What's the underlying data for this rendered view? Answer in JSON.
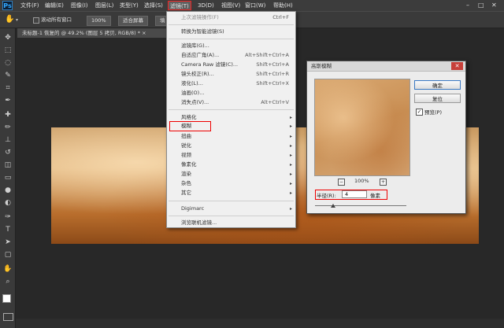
{
  "menubar": {
    "logo": "Ps",
    "items": [
      "文件(F)",
      "编辑(E)",
      "图像(I)",
      "图层(L)",
      "类型(Y)",
      "选择(S)",
      "滤镜(T)",
      "3D(D)",
      "视图(V)",
      "窗口(W)",
      "帮助(H)"
    ],
    "window_controls": [
      "–",
      "□",
      "✕"
    ]
  },
  "options_bar": {
    "checkbox_label": "滚动所有窗口",
    "zoom_value": "100%",
    "fit_screen": "适合屏幕",
    "fill_screen": "填"
  },
  "document": {
    "tab_title": "未标题-1 恢复的 @ 49.2% (图层 5 拷贝, RGB/8) * ×"
  },
  "filter_menu": {
    "top_items": [
      {
        "label": "上次滤镜操作(F)",
        "shortcut": "Ctrl+F",
        "disabled": true
      },
      {
        "label": "转换为智能滤镜(S)",
        "shortcut": "",
        "disabled": false
      }
    ],
    "mid_items": [
      {
        "label": "滤镜库(G)...",
        "shortcut": ""
      },
      {
        "label": "自适应广角(A)...",
        "shortcut": "Alt+Shift+Ctrl+A"
      },
      {
        "label": "Camera Raw 滤镜(C)...",
        "shortcut": "Shift+Ctrl+A"
      },
      {
        "label": "镜头校正(R)...",
        "shortcut": "Shift+Ctrl+R"
      },
      {
        "label": "液化(L)...",
        "shortcut": "Shift+Ctrl+X"
      },
      {
        "label": "油画(O)...",
        "shortcut": ""
      },
      {
        "label": "消失点(V)...",
        "shortcut": "Alt+Ctrl+V"
      }
    ],
    "submenus": [
      "风格化",
      "模糊",
      "扭曲",
      "锐化",
      "视频",
      "像素化",
      "渲染",
      "杂色",
      "其它"
    ],
    "plugin": "Digimarc",
    "browse": "浏览联机滤镜..."
  },
  "dialog": {
    "title": "高斯模糊",
    "close": "✕",
    "ok": "确定",
    "reset": "复位",
    "preview_label": "预览(P)",
    "preview_checked": "✓",
    "zoom_level": "100%",
    "zoom_out": "−",
    "zoom_in": "+",
    "radius_label": "半径(R):",
    "radius_value": "4",
    "radius_unit": "像素",
    "slider_fraction": 0.2
  },
  "toolbar": {
    "tools": [
      "move-tool-icon",
      "marquee-icon",
      "lasso-icon",
      "quick-select-icon",
      "crop-icon",
      "eyedropper-icon",
      "healing-icon",
      "brush-icon",
      "stamp-icon",
      "history-brush-icon",
      "eraser-icon",
      "gradient-icon",
      "blur-icon",
      "dodge-icon",
      "pen-icon",
      "type-icon",
      "path-select-icon",
      "shape-icon",
      "hand-icon",
      "zoom-icon"
    ],
    "glyphs": [
      "✥",
      "⬚",
      "◌",
      "✎",
      "⌗",
      "✒",
      "✚",
      "✏",
      "⊥",
      "↺",
      "◫",
      "▭",
      "●",
      "◐",
      "✑",
      "T",
      "➤",
      "▢",
      "✋",
      "⌕"
    ]
  }
}
